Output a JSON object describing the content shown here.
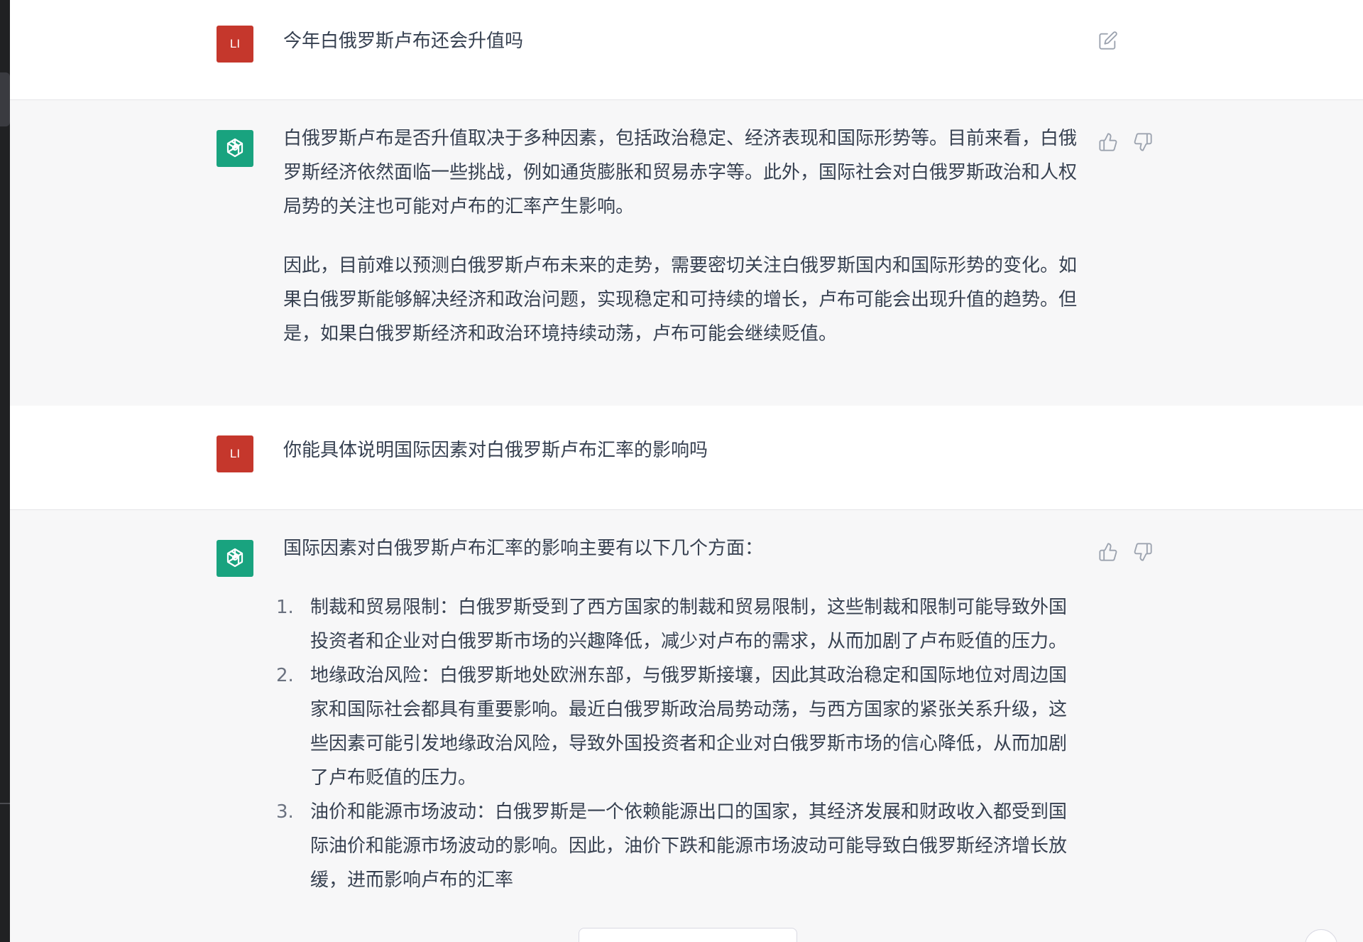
{
  "conversation": {
    "user_avatar_text": "LI",
    "turns": [
      {
        "role": "user",
        "text": "今年白俄罗斯卢布还会升值吗"
      },
      {
        "role": "assistant",
        "paragraphs": [
          "白俄罗斯卢布是否升值取决于多种因素，包括政治稳定、经济表现和国际形势等。目前来看，白俄罗斯经济依然面临一些挑战，例如通货膨胀和贸易赤字等。此外，国际社会对白俄罗斯政治和人权局势的关注也可能对卢布的汇率产生影响。",
          "因此，目前难以预测白俄罗斯卢布未来的走势，需要密切关注白俄罗斯国内和国际形势的变化。如果白俄罗斯能够解决经济和政治问题，实现稳定和可持续的增长，卢布可能会出现升值的趋势。但是，如果白俄罗斯经济和政治环境持续动荡，卢布可能会继续贬值。"
        ]
      },
      {
        "role": "user",
        "text": "你能具体说明国际因素对白俄罗斯卢布汇率的影响吗"
      },
      {
        "role": "assistant",
        "intro": "国际因素对白俄罗斯卢布汇率的影响主要有以下几个方面：",
        "list": [
          {
            "num": "1.",
            "text": "制裁和贸易限制：白俄罗斯受到了西方国家的制裁和贸易限制，这些制裁和限制可能导致外国投资者和企业对白俄罗斯市场的兴趣降低，减少对卢布的需求，从而加剧了卢布贬值的压力。"
          },
          {
            "num": "2.",
            "text": "地缘政治风险：白俄罗斯地处欧洲东部，与俄罗斯接壤，因此其政治稳定和国际地位对周边国家和国际社会都具有重要影响。最近白俄罗斯政治局势动荡，与西方国家的紧张关系升级，这些因素可能引发地缘政治风险，导致外国投资者和企业对白俄罗斯市场的信心降低，从而加剧了卢布贬值的压力。"
          },
          {
            "num": "3.",
            "text": "油价和能源市场波动：白俄罗斯是一个依赖能源出口的国家，其经济发展和财政收入都受到国际油价和能源市场波动的影响。因此，油价下跌和能源市场波动可能导致白俄罗斯经济增长放缓，进而影响卢布的汇率"
          }
        ]
      }
    ]
  },
  "icons": {
    "edit": "edit-icon",
    "thumbs_up": "thumbs-up-icon",
    "thumbs_down": "thumbs-down-icon",
    "bot_logo": "openai-logo-icon"
  },
  "colors": {
    "user_avatar": "#c5372c",
    "bot_avatar": "#19a37f",
    "assistant_bg": "#f7f7f8",
    "text": "#374151"
  }
}
